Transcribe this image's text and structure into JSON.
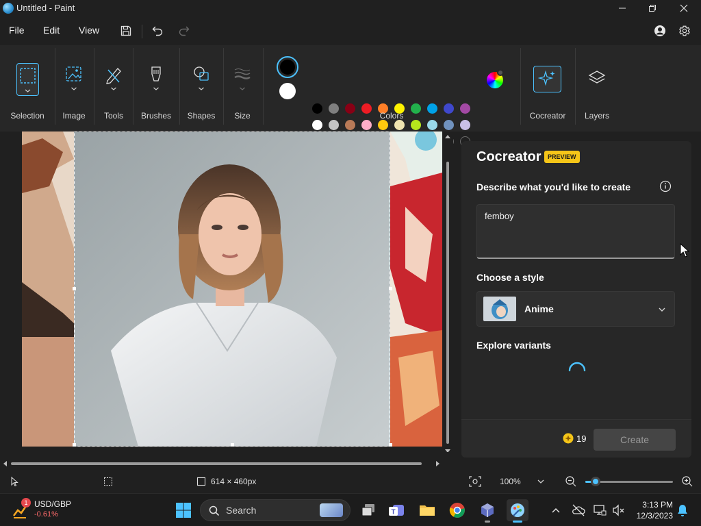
{
  "window": {
    "title": "Untitled - Paint"
  },
  "menu": {
    "file": "File",
    "edit": "Edit",
    "view": "View"
  },
  "ribbon": {
    "selection": "Selection",
    "image": "Image",
    "tools": "Tools",
    "brushes": "Brushes",
    "shapes": "Shapes",
    "size": "Size",
    "colors": "Colors",
    "cocreator": "Cocreator",
    "layers": "Layers",
    "primary_color": "#000000",
    "secondary_color": "#ffffff",
    "palette_row1": [
      "#000000",
      "#7f7f7f",
      "#880015",
      "#ed1c24",
      "#ff7f27",
      "#fff200",
      "#22b14c",
      "#00a2e8",
      "#3f48cc",
      "#a349a4"
    ],
    "palette_row2": [
      "#ffffff",
      "#c3c3c3",
      "#b97a57",
      "#ffaec9",
      "#ffc90e",
      "#efe4b0",
      "#b5e61d",
      "#99d9ea",
      "#7092be",
      "#c8bfe7"
    ]
  },
  "cocreator": {
    "title": "Cocreator",
    "badge": "PREVIEW",
    "describe_label": "Describe what you'd like to create",
    "prompt_value": "femboy",
    "style_label": "Choose a style",
    "style_value": "Anime",
    "variants_label": "Explore variants",
    "credits": "19",
    "create_label": "Create"
  },
  "status": {
    "dimensions": "614 × 460px",
    "zoom": "100%",
    "zoom_level_fraction": 0.12
  },
  "taskbar": {
    "widget_title": "USD/GBP",
    "widget_value": "-0.61%",
    "widget_badge": "1",
    "search_label": "Search",
    "time": "3:13 PM",
    "date": "12/3/2023"
  },
  "colors": {
    "accent": "#4cc2ff",
    "panel_bg": "#272727",
    "app_bg": "#202020",
    "badge_bg": "#f5c518",
    "negative": "#ff6b6b"
  }
}
